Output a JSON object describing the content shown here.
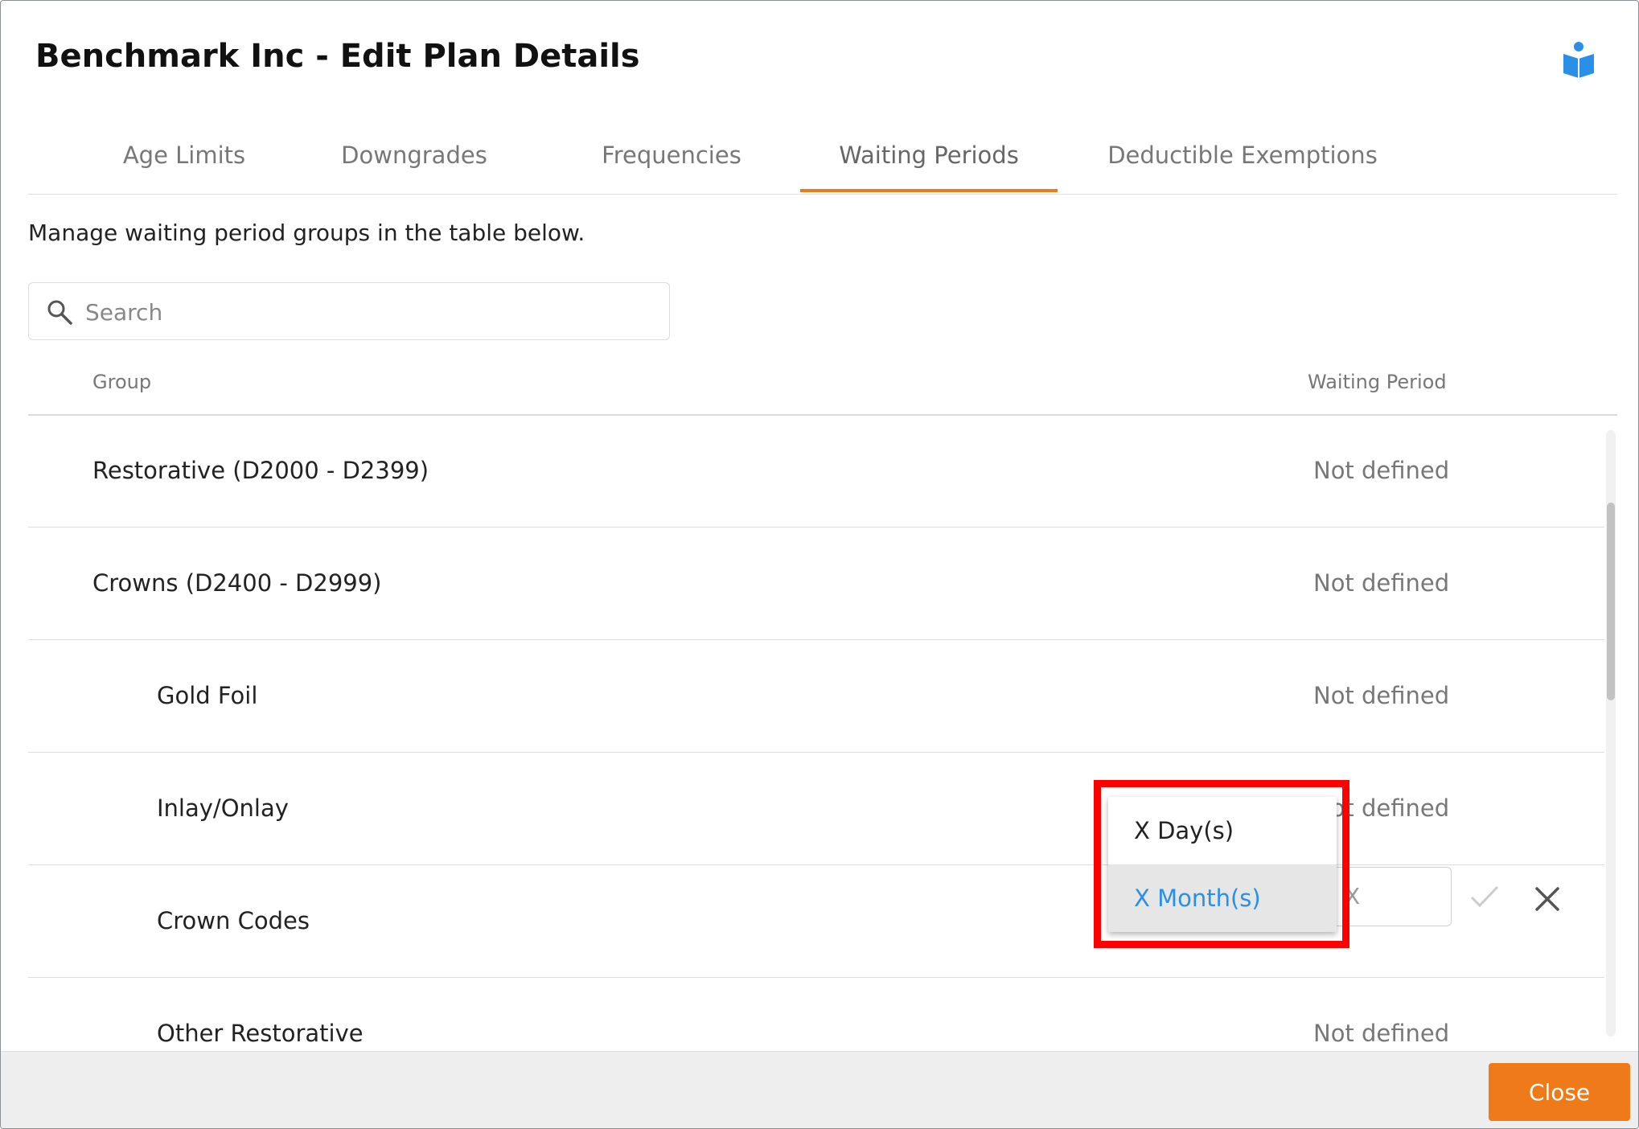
{
  "header": {
    "title": "Benchmark Inc - Edit Plan Details"
  },
  "tabs": [
    {
      "label": "Age Limits"
    },
    {
      "label": "Downgrades"
    },
    {
      "label": "Frequencies"
    },
    {
      "label": "Waiting Periods",
      "active": true
    },
    {
      "label": "Deductible Exemptions"
    }
  ],
  "description": "Manage waiting period groups in the table below.",
  "search": {
    "placeholder": "Search"
  },
  "table": {
    "columns": {
      "group": "Group",
      "waiting_period": "Waiting Period"
    },
    "rows": [
      {
        "group": "Restorative (D2000 - D2399)",
        "waiting_period": "Not defined"
      },
      {
        "group": "Crowns (D2400 - D2999)",
        "waiting_period": "Not defined"
      },
      {
        "group": "Gold Foil",
        "waiting_period": "Not defined"
      },
      {
        "group": "Inlay/Onlay",
        "waiting_period": "Not defined"
      },
      {
        "group": "Crown Codes",
        "editing": true
      },
      {
        "group": "Other Restorative",
        "waiting_period": "Not defined"
      }
    ]
  },
  "editor": {
    "input_value": "X"
  },
  "dropdown": {
    "options": [
      "X Day(s)",
      "X Month(s)"
    ],
    "highlighted": "X Month(s)"
  },
  "footer": {
    "close_label": "Close"
  },
  "colors": {
    "accent": "#ef7a1a",
    "link_blue": "#2a8fe6",
    "highlight_red": "#ff0000"
  }
}
